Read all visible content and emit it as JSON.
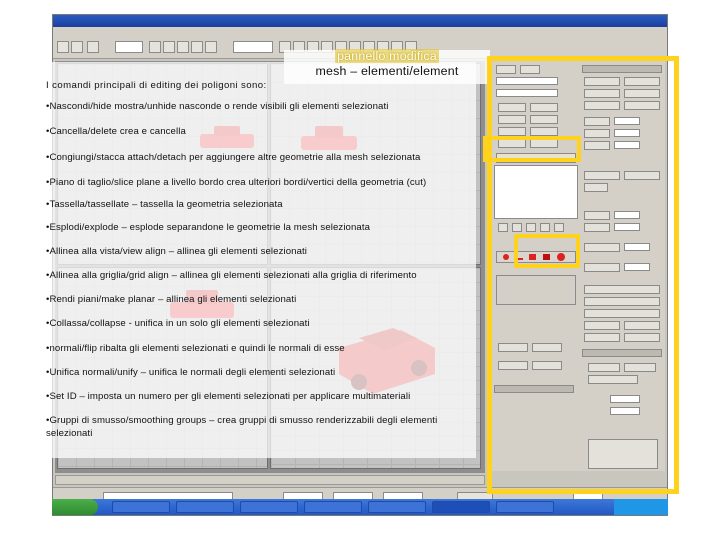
{
  "slide": {
    "title_line1": "pannello modifica",
    "title_line2": "mesh – elementi/element",
    "intro": "I comandi  principali di editing dei poligoni sono:",
    "bullets": [
      "•Nascondi/hide mostra/unhide nasconde o rende visibili gli elementi selezionati",
      "•Cancella/delete crea e cancella",
      "•Congiungi/stacca attach/detach per aggiungere altre geometrie alla mesh selezionata",
      "•Piano di taglio/slice plane a livello bordo crea ulteriori bordi/vertici della geometria (cut)",
      "•Tassella/tassellate – tassella la geometria selezionata",
      "•Esplodi/explode – esplode separandone le geometrie la mesh selezionata",
      "•Allinea alla vista/view align – allinea gli elementi selezionati",
      "•Allinea alla griglia/grid align – allinea gli elementi selezionati alla griglia di riferimento",
      "•Rendi piani/make planar – allinea gli elementi selezionati",
      "•Collassa/collapse  - unifica in un solo gli elementi selezionati",
      "•normali/flip ribalta gli elementi selezionati e quindi le normali di esse",
      "•Unifica normali/unify – unifica le normali degli elementi selezionati",
      "•Set ID – imposta un numero per gli elementi selezionati per applicare multimateriali",
      "•Gruppi di smusso/smoothing groups – crea gruppi di smusso renderizzabili degli elementi selezionati"
    ]
  },
  "colors": {
    "highlight_frame": "#ffd21e",
    "title_highlight": "#e1c328",
    "car_red": "#e23a3a",
    "window_chrome": "#d4d0c8"
  }
}
